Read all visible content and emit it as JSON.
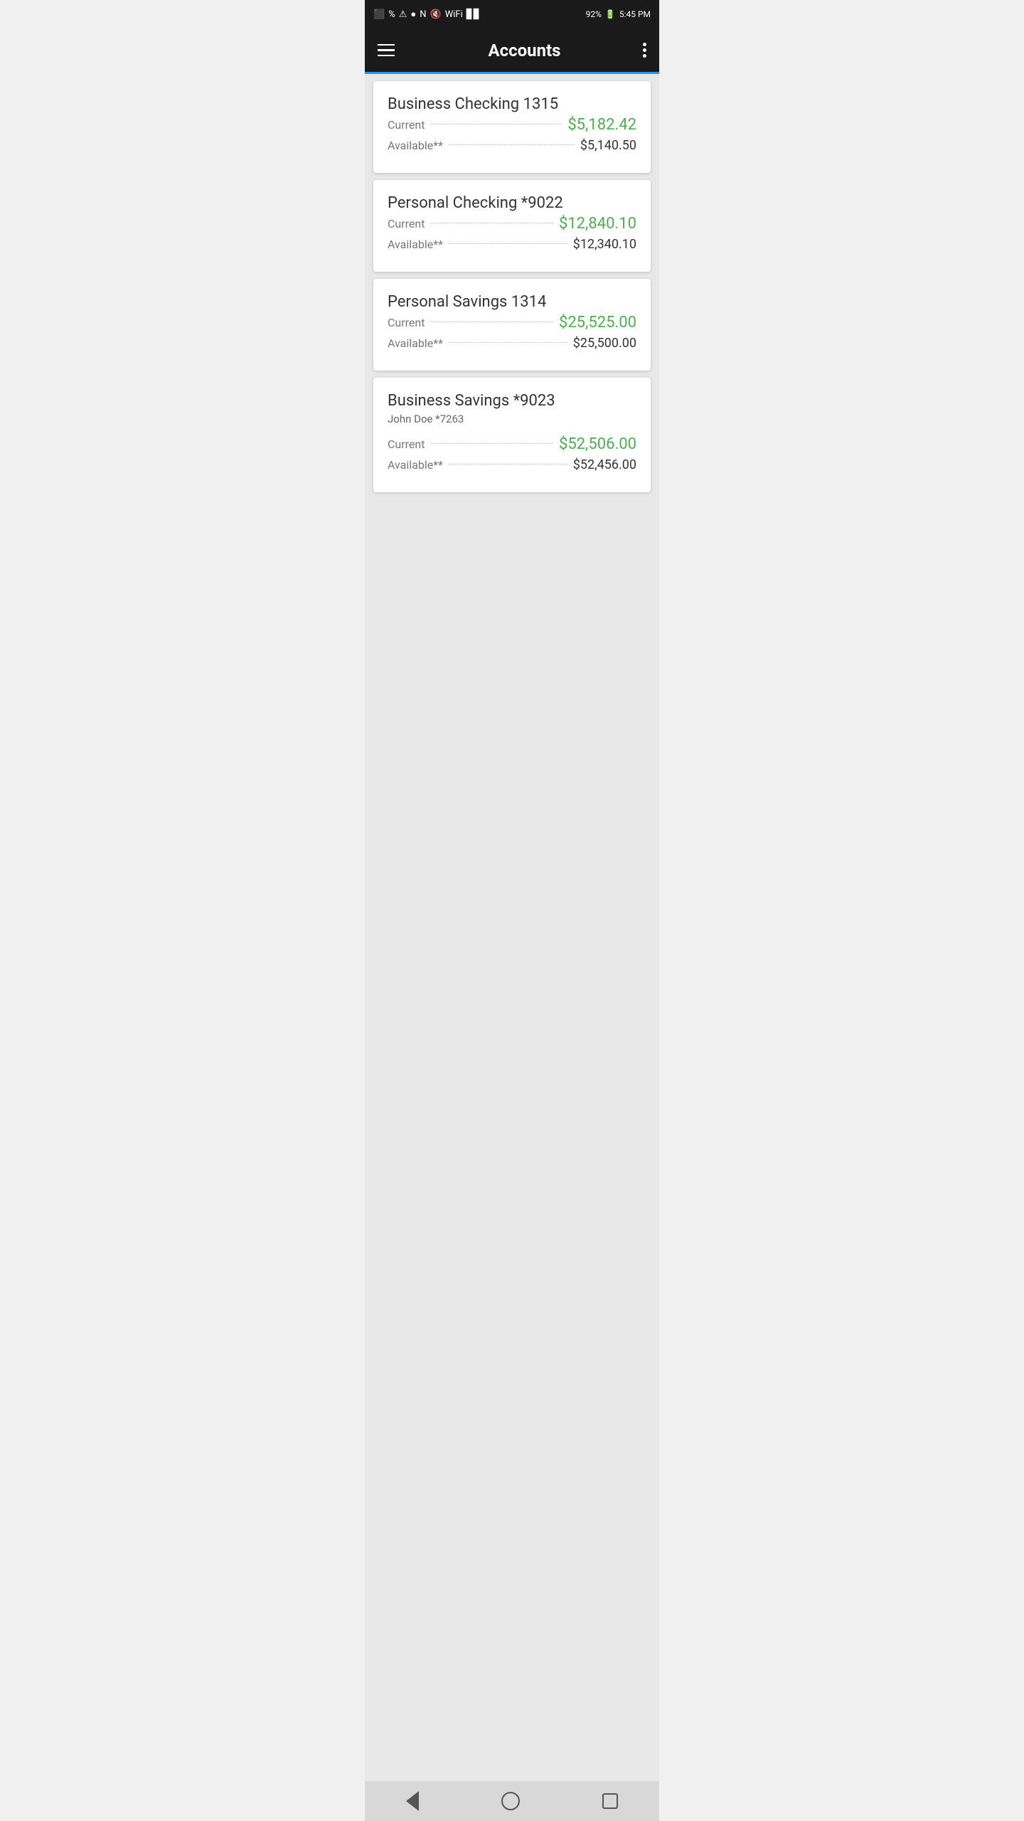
{
  "status_bar": {
    "time": "5:45 PM",
    "battery": "92%",
    "icons_left": [
      "⬛",
      "🔔",
      "⚠"
    ],
    "icons_right": [
      "BT",
      "NFC",
      "🔇",
      "WiFi",
      "📶"
    ]
  },
  "app_bar": {
    "title": "Accounts",
    "menu_icon": "hamburger",
    "more_icon": "dots"
  },
  "accounts": [
    {
      "name": "Business Checking 1315",
      "sub": null,
      "current_label": "Current",
      "current_amount": "$5,182.42",
      "available_label": "Available**",
      "available_amount": "$5,140.50"
    },
    {
      "name": "Personal Checking *9022",
      "sub": null,
      "current_label": "Current",
      "current_amount": "$12,840.10",
      "available_label": "Available**",
      "available_amount": "$12,340.10"
    },
    {
      "name": "Personal Savings 1314",
      "sub": null,
      "current_label": "Current",
      "current_amount": "$25,525.00",
      "available_label": "Available**",
      "available_amount": "$25,500.00"
    },
    {
      "name": "Business Savings *9023",
      "sub": "John Doe *7263",
      "current_label": "Current",
      "current_amount": "$52,506.00",
      "available_label": "Available**",
      "available_amount": "$52,456.00"
    }
  ],
  "bottom_nav": {
    "back_label": "back",
    "home_label": "home",
    "recent_label": "recent"
  }
}
